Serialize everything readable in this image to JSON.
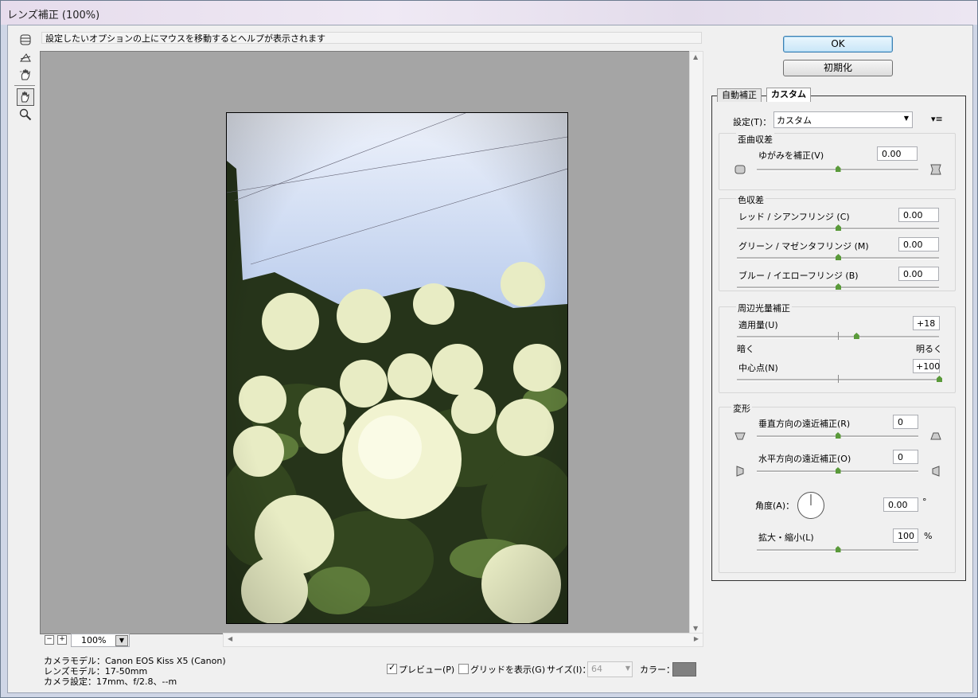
{
  "window": {
    "title": "レンズ補正 (100%)"
  },
  "help_text": "設定したいオプションの上にマウスを移動するとヘルプが表示されます",
  "toolbar": {
    "tools": [
      "remove-distortion-tool",
      "straighten-tool",
      "move-grid-tool",
      "hand-tool",
      "zoom-tool"
    ],
    "selected": "hand-tool"
  },
  "zoom": {
    "value": "100%",
    "minus": "−",
    "plus": "+"
  },
  "camera_info": {
    "model": "カメラモデル：Canon EOS Kiss X5 (Canon)",
    "lens": "レンズモデル：17-50mm",
    "settings": "カメラ設定：17mm、f/2.8、--m"
  },
  "bottom": {
    "preview_label": "プレビュー(P)",
    "preview_checked": true,
    "grid_label": "グリッドを表示(G)",
    "grid_checked": false,
    "size_label": "サイズ(I)：",
    "size_value": "64",
    "color_label": "カラー：",
    "color_swatch": "#808080"
  },
  "buttons": {
    "ok": "OK",
    "reset": "初期化"
  },
  "tabs": [
    {
      "label": "自動補正",
      "active": false
    },
    {
      "label": "カスタム",
      "active": true
    }
  ],
  "settings": {
    "label": "設定(T)：",
    "value": "カスタム"
  },
  "distortion": {
    "title": "歪曲収差",
    "remove_label": "ゆがみを補正(V)",
    "remove_value": "0.00",
    "slider": 0.5
  },
  "chromatic": {
    "title": "色収差",
    "items": [
      {
        "label": "レッド / シアンフリンジ (C)",
        "value": "0.00",
        "slider": 0.5
      },
      {
        "label": "グリーン / マゼンタフリンジ (M)",
        "value": "0.00",
        "slider": 0.5
      },
      {
        "label": "ブルー / イエローフリンジ (B)",
        "value": "0.00",
        "slider": 0.5
      }
    ]
  },
  "vignette": {
    "title": "周辺光量補正",
    "amount_label": "適用量(U)",
    "amount_value": "+18",
    "amount_slider": 0.59,
    "dark_label": "暗く",
    "bright_label": "明るく",
    "midpoint_label": "中心点(N)",
    "midpoint_value": "+100",
    "midpoint_slider": 1.0
  },
  "transform": {
    "title": "変形",
    "vertical_label": "垂直方向の遠近補正(R)",
    "vertical_value": "0",
    "vertical_slider": 0.5,
    "horizontal_label": "水平方向の遠近補正(O)",
    "horizontal_value": "0",
    "horizontal_slider": 0.5,
    "angle_label": "角度(A)：",
    "angle_value": "0.00",
    "angle_unit": "°",
    "scale_label": "拡大・縮小(L)",
    "scale_value": "100",
    "scale_unit": "%",
    "scale_slider": 0.5
  }
}
